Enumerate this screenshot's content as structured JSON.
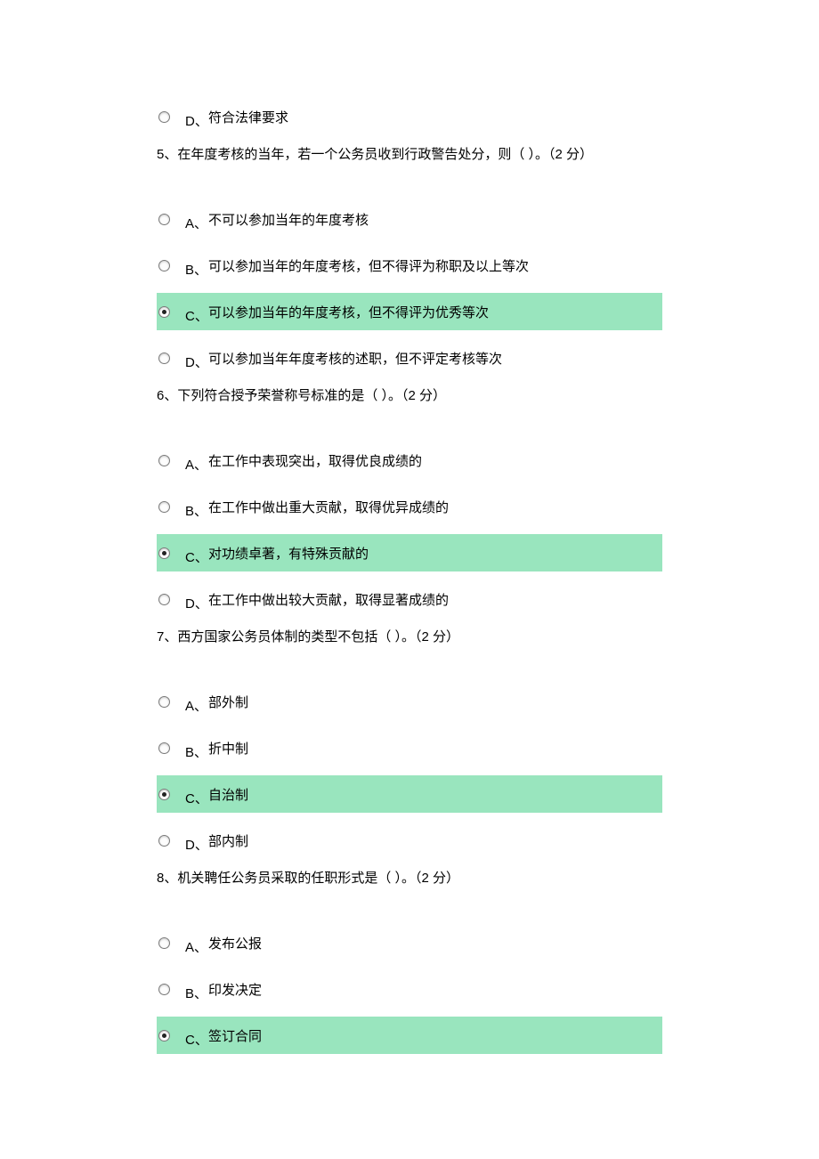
{
  "standalone_option": {
    "letter": "D、",
    "text": "符合法律要求",
    "selected": false,
    "highlighted": false
  },
  "questions": [
    {
      "prompt": "5、在年度考核的当年，若一个公务员收到行政警告处分，则（ ）。（2 分）",
      "options": [
        {
          "letter": "A、",
          "text": "不可以参加当年的年度考核",
          "selected": false,
          "highlighted": false
        },
        {
          "letter": "B、",
          "text": "可以参加当年的年度考核，但不得评为称职及以上等次",
          "selected": false,
          "highlighted": false
        },
        {
          "letter": "C、",
          "text": "可以参加当年的年度考核，但不得评为优秀等次",
          "selected": true,
          "highlighted": true
        },
        {
          "letter": "D、",
          "text": "可以参加当年年度考核的述职，但不评定考核等次",
          "selected": false,
          "highlighted": false
        }
      ]
    },
    {
      "prompt": "6、下列符合授予荣誉称号标准的是（ ）。（2 分）",
      "options": [
        {
          "letter": "A、",
          "text": "在工作中表现突出，取得优良成绩的",
          "selected": false,
          "highlighted": false
        },
        {
          "letter": "B、",
          "text": "在工作中做出重大贡献，取得优异成绩的",
          "selected": false,
          "highlighted": false
        },
        {
          "letter": "C、",
          "text": "对功绩卓著，有特殊贡献的",
          "selected": true,
          "highlighted": true
        },
        {
          "letter": "D、",
          "text": "在工作中做出较大贡献，取得显著成绩的",
          "selected": false,
          "highlighted": false
        }
      ]
    },
    {
      "prompt": "7、西方国家公务员体制的类型不包括（ ）。（2 分）",
      "options": [
        {
          "letter": "A、",
          "text": "部外制",
          "selected": false,
          "highlighted": false
        },
        {
          "letter": "B、",
          "text": "折中制",
          "selected": false,
          "highlighted": false
        },
        {
          "letter": "C、",
          "text": "自治制",
          "selected": true,
          "highlighted": true
        },
        {
          "letter": "D、",
          "text": "部内制",
          "selected": false,
          "highlighted": false
        }
      ]
    },
    {
      "prompt": "8、机关聘任公务员采取的任职形式是（ ）。（2 分）",
      "options": [
        {
          "letter": "A、",
          "text": "发布公报",
          "selected": false,
          "highlighted": false
        },
        {
          "letter": "B、",
          "text": "印发决定",
          "selected": false,
          "highlighted": false
        },
        {
          "letter": "C、",
          "text": "签订合同",
          "selected": true,
          "highlighted": true
        }
      ]
    }
  ]
}
